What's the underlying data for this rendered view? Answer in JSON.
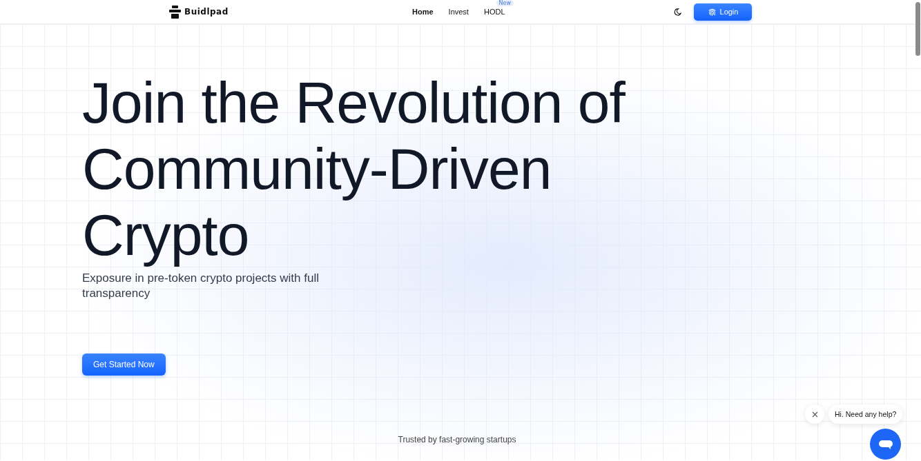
{
  "header": {
    "logo": "Buidlpad",
    "nav": [
      {
        "label": "Home",
        "selected": true
      },
      {
        "label": "Invest",
        "selected": false
      },
      {
        "label": "HODL",
        "selected": false,
        "badge": "New"
      }
    ],
    "login": "Login"
  },
  "hero": {
    "title": "Join the Revolution of Community-Driven Crypto",
    "subtitle": "Exposure in pre-token crypto projects with full transparency",
    "cta": "Get Started Now"
  },
  "trusted": "Trusted by fast-growing startups",
  "chat": {
    "message": "Hi. Need any help?"
  }
}
